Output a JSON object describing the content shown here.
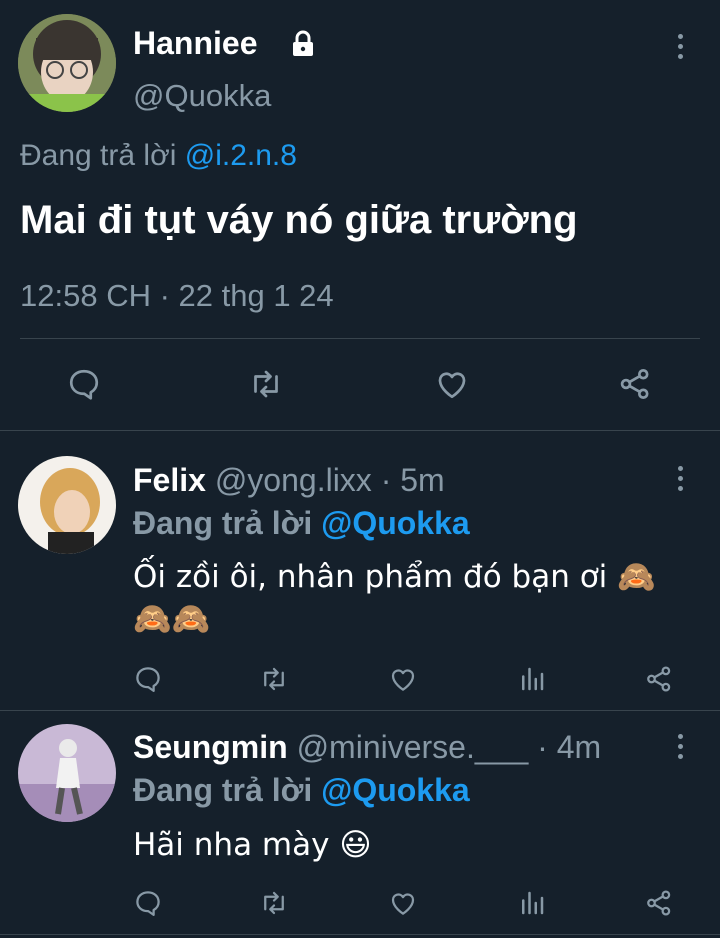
{
  "main_tweet": {
    "display_name": "Hanniee",
    "handle": "@Quokka",
    "replying_prefix": "Đang trả lời",
    "replying_to": "@i.2.n.8",
    "text": "Mai đi tụt váy nó giữa trường",
    "timestamp": "12:58 CH · 22 thg 1 24",
    "lock_icon": "lock-icon",
    "actions": [
      "reply-icon",
      "retweet-icon",
      "like-icon",
      "share-icon"
    ]
  },
  "replies": [
    {
      "display_name": "Felix",
      "handle": "@yong.lixx",
      "time": "· 5m",
      "replying_prefix": "Đang trả lời",
      "replying_to": "@Quokka",
      "text_line1": "Ối zồi ôi, nhân phẩm đó bạn ơi 🙈",
      "text_line2": "🙈🙈",
      "actions": [
        "reply-icon",
        "retweet-icon",
        "like-icon",
        "analytics-icon",
        "share-icon"
      ]
    },
    {
      "display_name": "Seungmin",
      "handle": "@miniverse.___",
      "time": "· 4m",
      "replying_prefix": "Đang trả lời",
      "replying_to": "@Quokka",
      "text_line1": "Hãi nha mày 😃",
      "actions": [
        "reply-icon",
        "retweet-icon",
        "like-icon",
        "analytics-icon",
        "share-icon"
      ]
    }
  ],
  "colors": {
    "background": "#15202b",
    "accent": "#1d9bf0",
    "muted": "#8899a6",
    "divider": "#38444d"
  }
}
